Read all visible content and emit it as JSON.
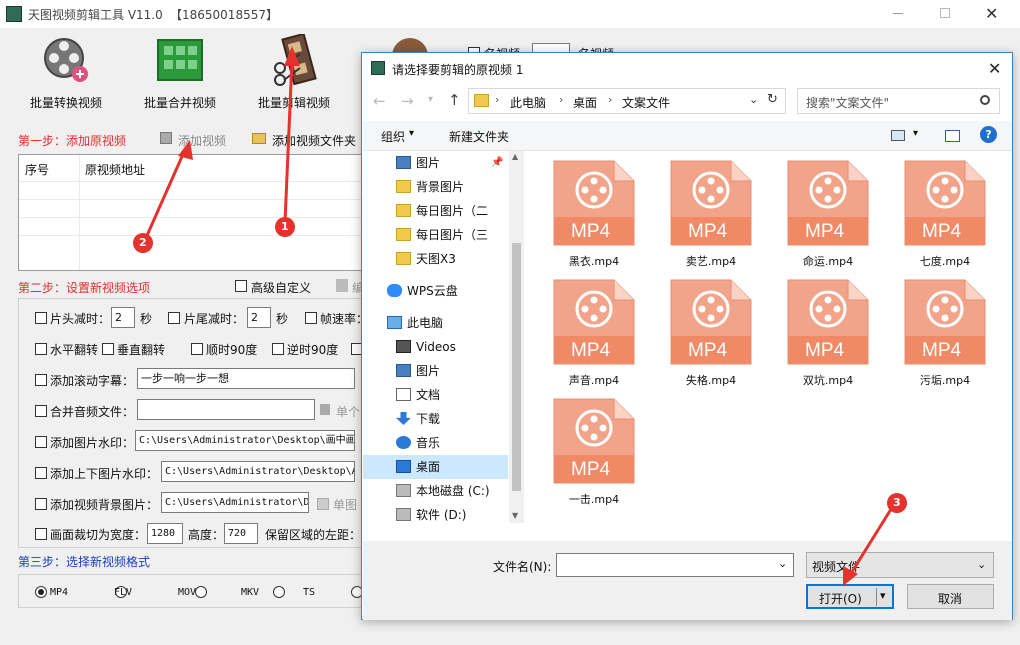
{
  "app": {
    "title": "天图视频剪辑工具 V11.0",
    "phone": "【18650018557】",
    "tools": [
      {
        "label": "批量转换视频"
      },
      {
        "label": "批量合并视频"
      },
      {
        "label": "批量剪辑视频"
      }
    ],
    "top_checkbox_a": "名视频",
    "top_checkbox_b": "名视频",
    "step1": {
      "label": "第一步：添加原视频",
      "add_video": "添加视频",
      "add_folder": "添加视频文件夹",
      "col_index": "序号",
      "col_path": "原视频地址"
    },
    "step2": {
      "label": "第二步：设置新视频选项",
      "advanced": "高级自定义",
      "edit_hint": "编",
      "cut_head": "片头减时：",
      "cut_head_val": "2",
      "cut_head_unit": "秒",
      "cut_tail": "片尾减时：",
      "cut_tail_val": "2",
      "cut_tail_unit": "秒",
      "frame_rate": "帧速率：",
      "hflip": "水平翻转",
      "vflip": "垂直翻转",
      "rot_cw": "顺时90度",
      "rot_ccw": "逆时90度",
      "scroll_text": "添加滚动字幕：",
      "scroll_text_val": "一步一响一步一想",
      "merge_audio": "合并音频文件：",
      "merge_audio_val": "",
      "single_audio": "单个",
      "img_watermark": "添加图片水印：",
      "img_watermark_val": "C:\\Users\\Administrator\\Desktop\\画中画",
      "updown_watermark": "添加上下图片水印：",
      "updown_watermark_val": "C:\\Users\\Administrator\\Desktop\\A",
      "bg_image": "添加视频背景图片：",
      "bg_image_val": "C:\\Users\\Administrator\\D",
      "single_image": "单图",
      "crop_width": "画面裁切为宽度：",
      "crop_width_val": "1280",
      "crop_height": "高度：",
      "crop_height_val": "720",
      "keep_left": "保留区域的左距："
    },
    "step3": {
      "label": "第三步：选择新视频格式",
      "formats": [
        "MP4",
        "FLV",
        "MOV",
        "MKV",
        "TS"
      ],
      "selected": "MP4"
    }
  },
  "annotations": [
    "1",
    "2",
    "3"
  ],
  "dialog": {
    "title": "请选择要剪辑的原视频 1",
    "breadcrumb": [
      "此电脑",
      "桌面",
      "文案文件"
    ],
    "search_placeholder": "搜索\"文案文件\"",
    "organize": "组织",
    "new_folder": "新建文件夹",
    "nav": [
      {
        "label": "图片",
        "icon": "picture-icon"
      },
      {
        "label": "背景图片",
        "icon": "folder-icon"
      },
      {
        "label": "每日图片（二",
        "icon": "folder-icon"
      },
      {
        "label": "每日图片（三",
        "icon": "folder-icon"
      },
      {
        "label": "天图X3",
        "icon": "folder-icon"
      },
      {
        "label": "WPS云盘",
        "icon": "cloud-icon"
      },
      {
        "label": "此电脑",
        "icon": "computer-icon"
      },
      {
        "label": "Videos",
        "icon": "video-icon"
      },
      {
        "label": "图片",
        "icon": "picture-icon"
      },
      {
        "label": "文档",
        "icon": "document-icon"
      },
      {
        "label": "下载",
        "icon": "download-icon"
      },
      {
        "label": "音乐",
        "icon": "music-icon"
      },
      {
        "label": "桌面",
        "icon": "desktop-icon"
      },
      {
        "label": "本地磁盘 (C:)",
        "icon": "disk-icon"
      },
      {
        "label": "软件 (D:)",
        "icon": "disk-icon"
      }
    ],
    "files": [
      "黑衣.mp4",
      "卖艺.mp4",
      "命运.mp4",
      "七度.mp4",
      "声音.mp4",
      "失格.mp4",
      "双坑.mp4",
      "污垢.mp4",
      "一击.mp4"
    ],
    "file_badge": "MP4",
    "filename_label": "文件名(N):",
    "filename_value": "",
    "filetype": "视频文件",
    "open_button": "打开(O)",
    "cancel_button": "取消"
  }
}
